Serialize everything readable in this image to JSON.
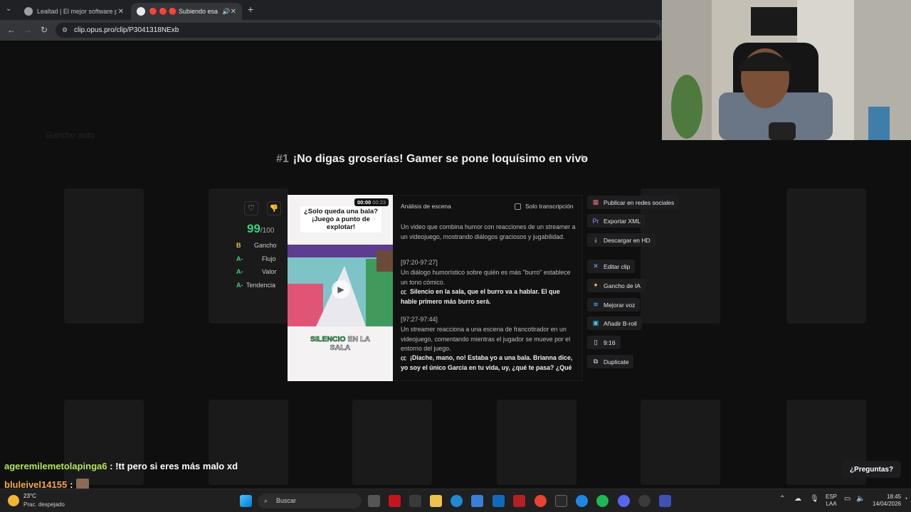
{
  "browser": {
    "tabs": [
      {
        "label": "Lealtad | El mejor software para"
      },
      {
        "label": "🔴 🔴 🔴 Subiendo esa RAC"
      }
    ],
    "url": "clip.opus.pro/clip/P3041318NExb"
  },
  "clip": {
    "number": "#1",
    "title": "¡No digas groserías! Gamer se pone loquísimo en vivo",
    "video": {
      "time_current": "00:00",
      "time_total": "00:23",
      "caption_top": "¿Solo queda una bala? ¡Juego a punto de explotar!",
      "caption_bottom_1": "SILENCIO",
      "caption_bottom_2": "EN LA",
      "caption_bottom_3": "SALA"
    },
    "score": {
      "value": "99",
      "max": "/100"
    },
    "grades": [
      {
        "grade": "B",
        "label": "Gancho",
        "color": "#e6c53a"
      },
      {
        "grade": "A-",
        "label": "Flujo",
        "color": "#39d07f"
      },
      {
        "grade": "A-",
        "label": "Valor",
        "color": "#39d07f"
      },
      {
        "grade": "A-",
        "label": "Tendencia",
        "color": "#39d07f"
      }
    ],
    "analysis": {
      "heading": "Análisis de escena",
      "transcript_only": "Solo transcripción",
      "summary": "Un video que combina humor con reacciones de un streamer a un videojuego, mostrando diálogos graciosos y jugabilidad.",
      "segments": [
        {
          "time": "[97:20-97:27]",
          "description": "Un diálogo humorístico sobre quién es más \"burro\" establece un tono cómico.",
          "transcript": "Silencio en la sala, que el burro va a hablar. El que hable primero más burro será."
        },
        {
          "time": "[97:27-97:44]",
          "description": "Un streamer reacciona a una escena de francotirador en un videojuego, comentando mientras el jugador se mueve por el entorno del juego.",
          "transcript": "¡Diache, mano, no! Estaba yo a una bala. Brianna dice, yo soy el único García en tu vida, uy, ¿qué te pasa? ¿Qué"
        }
      ]
    },
    "actions": {
      "publish": "Publicar en redes sociales",
      "export_xml": "Exportar XML",
      "download_hd": "Descargar en HD",
      "edit": "Editar clip",
      "ai_hook": "Gancho de IA",
      "enhance_voice": "Mejorar voz",
      "add_broll": "Añadir B-roll",
      "ratio": "9:16",
      "duplicate": "Duplicate"
    }
  },
  "chat": [
    {
      "user": "ageremilemetolapinga6",
      "message": ": !tt pero si eres más malo xd"
    },
    {
      "user": "bluleivel14155",
      "message": ":"
    }
  ],
  "help_button": "¿Preguntas?",
  "taskbar": {
    "weather_temp": "23°C",
    "weather_desc": "Prac. despejado",
    "search_placeholder": "Buscar",
    "lang_1": "ESP",
    "lang_2": "LAA",
    "time": "18:45",
    "date": "14/04/2026"
  },
  "colors": {
    "accent_green": "#39d07f",
    "grade_b": "#e6c53a",
    "caption_green": "#35d65c"
  }
}
